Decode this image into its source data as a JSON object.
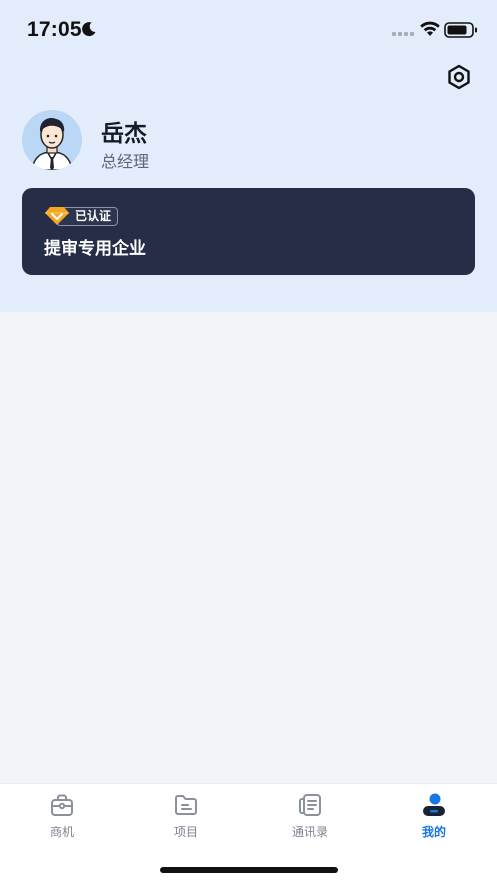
{
  "status_bar": {
    "time": "17:05",
    "icons": [
      "moon-icon",
      "signal-icon",
      "wifi-icon",
      "battery-icon"
    ]
  },
  "header": {
    "settings_icon": "settings-icon"
  },
  "profile": {
    "name": "岳杰",
    "title": "总经理",
    "avatar_icon": "avatar-illustration"
  },
  "company_card": {
    "verified_label": "已认证",
    "company_name": "提审专用企业",
    "badge_icon": "diamond-icon"
  },
  "tabs": [
    {
      "label": "商机",
      "icon": "briefcase-icon",
      "active": false
    },
    {
      "label": "项目",
      "icon": "folder-icon",
      "active": false
    },
    {
      "label": "通讯录",
      "icon": "contacts-icon",
      "active": false
    },
    {
      "label": "我的",
      "icon": "user-icon",
      "active": true
    }
  ],
  "colors": {
    "header_bg": "#E3ECFB",
    "page_bg": "#F2F4F9",
    "card_bg": "#252D47",
    "accent": "#1976E6",
    "badge_gold": "#F5A623"
  }
}
